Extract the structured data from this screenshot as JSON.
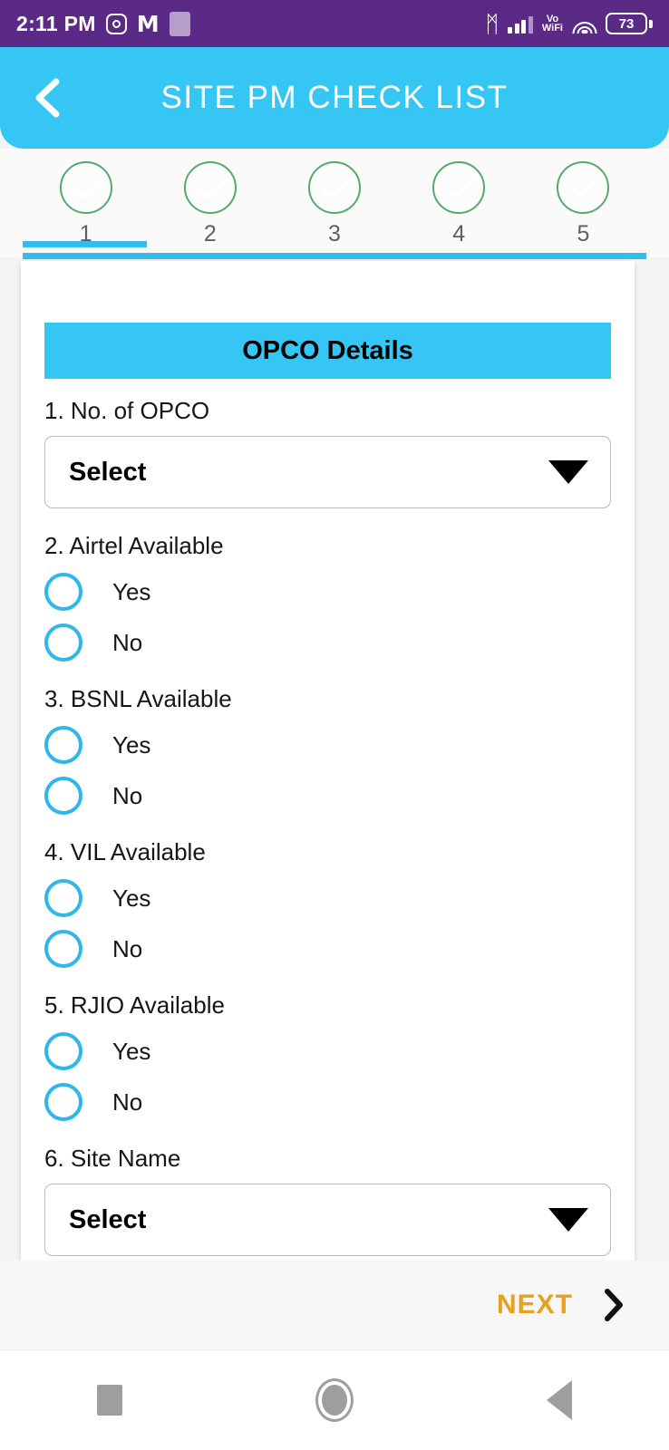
{
  "statusbar": {
    "time": "2:11 PM",
    "icons": [
      "instagram-icon",
      "gmail-icon",
      "photos-icon"
    ],
    "bluetooth_glyph": "ᛗ",
    "vo_label": "Vo",
    "wifi_label": "WiFi",
    "battery_level": "73"
  },
  "appbar": {
    "title": "SITE PM CHECK LIST",
    "back_icon": "chevron-left-icon",
    "background": "#35c6f4"
  },
  "stepper": {
    "steps": [
      {
        "number": "1",
        "active": true
      },
      {
        "number": "2",
        "active": false
      },
      {
        "number": "3",
        "active": false
      },
      {
        "number": "4",
        "active": false
      },
      {
        "number": "5",
        "active": false
      }
    ],
    "active_color": "#35bced",
    "circle_border_color": "#5aa86a"
  },
  "form": {
    "section_title": "OPCO Details",
    "questions": [
      {
        "label": "1. No. of OPCO",
        "type": "dropdown",
        "value": "Select"
      },
      {
        "label": "2. Airtel Available",
        "type": "radio",
        "options": [
          "Yes",
          "No"
        ],
        "selected": null
      },
      {
        "label": "3. BSNL Available",
        "type": "radio",
        "options": [
          "Yes",
          "No"
        ],
        "selected": null
      },
      {
        "label": "4. VIL Available",
        "type": "radio",
        "options": [
          "Yes",
          "No"
        ],
        "selected": null
      },
      {
        "label": "5. RJIO Available",
        "type": "radio",
        "options": [
          "Yes",
          "No"
        ],
        "selected": null
      },
      {
        "label": "6. Site Name",
        "type": "dropdown",
        "value": "Select"
      }
    ]
  },
  "footer": {
    "next_label": "NEXT",
    "next_icon": "chevron-right-icon",
    "next_color": "#e8a020"
  },
  "navbar": {
    "recents_icon": "square-icon",
    "home_icon": "circle-icon",
    "back_icon": "triangle-left-icon"
  }
}
